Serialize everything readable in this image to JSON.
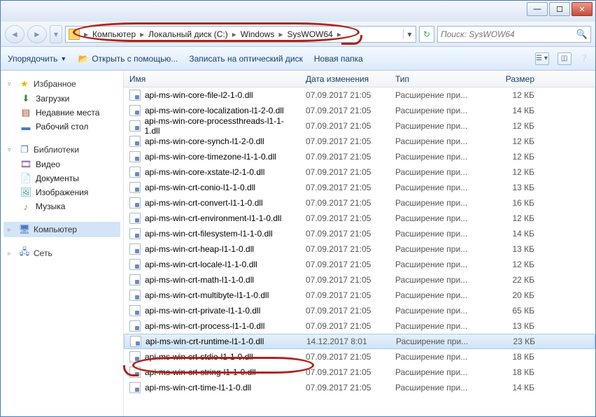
{
  "breadcrumb": [
    "Компьютер",
    "Локальный диск (C:)",
    "Windows",
    "SysWOW64"
  ],
  "search_placeholder": "Поиск: SysWOW64",
  "toolbar": {
    "organize": "Упорядочить",
    "open_with": "Открыть с помощью...",
    "burn": "Записать на оптический диск",
    "new_folder": "Новая папка"
  },
  "columns": {
    "name": "Имя",
    "date": "Дата изменения",
    "type": "Тип",
    "size": "Размер"
  },
  "sidebar": {
    "favorites": "Избранное",
    "downloads": "Загрузки",
    "recent": "Недавние места",
    "desktop": "Рабочий стол",
    "libraries": "Библиотеки",
    "video": "Видео",
    "documents": "Документы",
    "pictures": "Изображения",
    "music": "Музыка",
    "computer": "Компьютер",
    "network": "Сеть"
  },
  "files": [
    {
      "name": "api-ms-win-core-file-l2-1-0.dll",
      "date": "07.09.2017 21:05",
      "type": "Расширение при...",
      "size": "12 КБ"
    },
    {
      "name": "api-ms-win-core-localization-l1-2-0.dll",
      "date": "07.09.2017 21:05",
      "type": "Расширение при...",
      "size": "14 КБ"
    },
    {
      "name": "api-ms-win-core-processthreads-l1-1-1.dll",
      "date": "07.09.2017 21:05",
      "type": "Расширение при...",
      "size": "12 КБ"
    },
    {
      "name": "api-ms-win-core-synch-l1-2-0.dll",
      "date": "07.09.2017 21:05",
      "type": "Расширение при...",
      "size": "12 КБ"
    },
    {
      "name": "api-ms-win-core-timezone-l1-1-0.dll",
      "date": "07.09.2017 21:05",
      "type": "Расширение при...",
      "size": "12 КБ"
    },
    {
      "name": "api-ms-win-core-xstate-l2-1-0.dll",
      "date": "07.09.2017 21:05",
      "type": "Расширение при...",
      "size": "12 КБ"
    },
    {
      "name": "api-ms-win-crt-conio-l1-1-0.dll",
      "date": "07.09.2017 21:05",
      "type": "Расширение при...",
      "size": "13 КБ"
    },
    {
      "name": "api-ms-win-crt-convert-l1-1-0.dll",
      "date": "07.09.2017 21:05",
      "type": "Расширение при...",
      "size": "16 КБ"
    },
    {
      "name": "api-ms-win-crt-environment-l1-1-0.dll",
      "date": "07.09.2017 21:05",
      "type": "Расширение при...",
      "size": "12 КБ"
    },
    {
      "name": "api-ms-win-crt-filesystem-l1-1-0.dll",
      "date": "07.09.2017 21:05",
      "type": "Расширение при...",
      "size": "14 КБ",
      "sel_light": true
    },
    {
      "name": "api-ms-win-crt-heap-l1-1-0.dll",
      "date": "07.09.2017 21:05",
      "type": "Расширение при...",
      "size": "13 КБ"
    },
    {
      "name": "api-ms-win-crt-locale-l1-1-0.dll",
      "date": "07.09.2017 21:05",
      "type": "Расширение при...",
      "size": "12 КБ"
    },
    {
      "name": "api-ms-win-crt-math-l1-1-0.dll",
      "date": "07.09.2017 21:05",
      "type": "Расширение при...",
      "size": "22 КБ"
    },
    {
      "name": "api-ms-win-crt-multibyte-l1-1-0.dll",
      "date": "07.09.2017 21:05",
      "type": "Расширение при...",
      "size": "20 КБ"
    },
    {
      "name": "api-ms-win-crt-private-l1-1-0.dll",
      "date": "07.09.2017 21:05",
      "type": "Расширение при...",
      "size": "65 КБ"
    },
    {
      "name": "api-ms-win-crt-process-l1-1-0.dll",
      "date": "07.09.2017 21:05",
      "type": "Расширение при...",
      "size": "13 КБ"
    },
    {
      "name": "api-ms-win-crt-runtime-l1-1-0.dll",
      "date": "14.12.2017 8:01",
      "type": "Расширение при...",
      "size": "23 КБ",
      "selected": true
    },
    {
      "name": "api-ms-win-crt-stdio-l1-1-0.dll",
      "date": "07.09.2017 21:05",
      "type": "Расширение при...",
      "size": "18 КБ"
    },
    {
      "name": "api-ms-win-crt-string-l1-1-0.dll",
      "date": "07.09.2017 21:05",
      "type": "Расширение при...",
      "size": "18 КБ"
    },
    {
      "name": "api-ms-win-crt-time-l1-1-0.dll",
      "date": "07.09.2017 21:05",
      "type": "Расширение при...",
      "size": "14 КБ"
    }
  ]
}
